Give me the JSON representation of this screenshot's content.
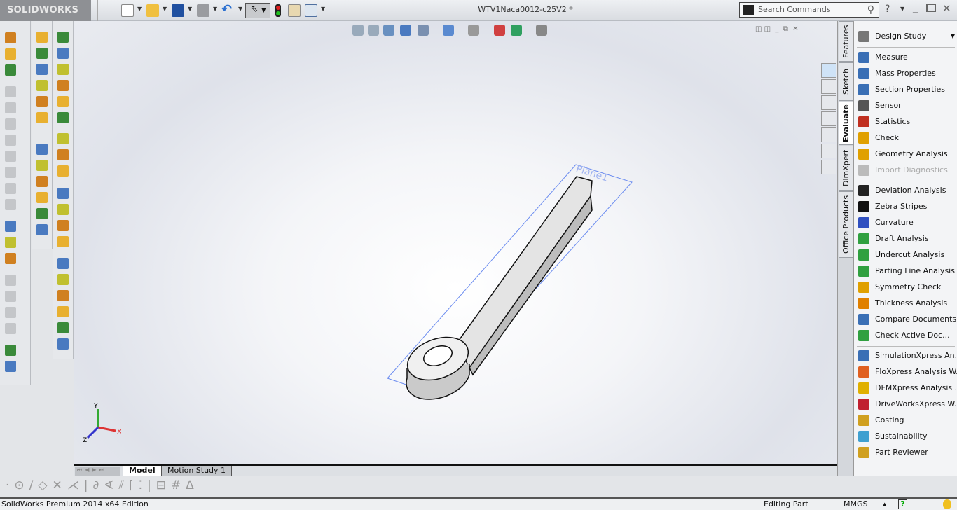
{
  "app": {
    "logo": "SOLIDWORKS",
    "document_title": "WTV1Naca0012-c25V2 *"
  },
  "toolbar": {
    "icons": [
      "new-icon",
      "open-icon",
      "save-icon",
      "print-icon",
      "undo-icon",
      "select-icon",
      "rebuild-icon",
      "file-properties-icon",
      "options-icon"
    ]
  },
  "search": {
    "placeholder": "Search Commands"
  },
  "right_tabs": [
    "Features",
    "Sketch",
    "Evaluate",
    "DimXpert",
    "Office Products"
  ],
  "active_tab": "Evaluate",
  "evaluate": {
    "header": "Design Study",
    "items": [
      {
        "label": "Measure",
        "color": "#3a6fb5"
      },
      {
        "label": "Mass Properties",
        "color": "#3a6fb5"
      },
      {
        "label": "Section Properties",
        "color": "#3a6fb5"
      },
      {
        "label": "Sensor",
        "color": "#555555"
      },
      {
        "label": "Statistics",
        "color": "#c03020"
      },
      {
        "label": "Check",
        "color": "#e0a000"
      },
      {
        "label": "Geometry Analysis",
        "color": "#e0a000"
      },
      {
        "label": "Import Diagnostics",
        "color": "#bbbbbb",
        "disabled": true
      },
      {
        "label": "Deviation Analysis",
        "color": "#222222"
      },
      {
        "label": "Zebra Stripes",
        "color": "#111111"
      },
      {
        "label": "Curvature",
        "color": "#3050c0"
      },
      {
        "label": "Draft Analysis",
        "color": "#30a040"
      },
      {
        "label": "Undercut Analysis",
        "color": "#30a040"
      },
      {
        "label": "Parting Line Analysis",
        "color": "#30a040"
      },
      {
        "label": "Symmetry Check",
        "color": "#e0a000"
      },
      {
        "label": "Thickness Analysis",
        "color": "#e08000"
      },
      {
        "label": "Compare Documents",
        "color": "#3a6fb5"
      },
      {
        "label": "Check Active Doc...",
        "color": "#30a040"
      },
      {
        "label": "SimulationXpress An...",
        "color": "#3a6fb5"
      },
      {
        "label": "FloXpress Analysis W...",
        "color": "#e06020"
      },
      {
        "label": "DFMXpress Analysis ...",
        "color": "#e0b000"
      },
      {
        "label": "DriveWorksXpress W...",
        "color": "#c02030"
      },
      {
        "label": "Costing",
        "color": "#d0a020"
      },
      {
        "label": "Sustainability",
        "color": "#40a0d0"
      },
      {
        "label": "Part Reviewer",
        "color": "#d0a020"
      }
    ]
  },
  "viewport": {
    "plane_label": "Plane1",
    "triad": {
      "x": "X",
      "y": "Y",
      "z": "Z"
    }
  },
  "bottom_tabs": [
    "Model",
    "Motion Study 1"
  ],
  "active_bottom_tab": "Model",
  "status": {
    "edition": "SolidWorks Premium 2014 x64 Edition",
    "mode": "Editing Part",
    "units": "MMGS"
  }
}
